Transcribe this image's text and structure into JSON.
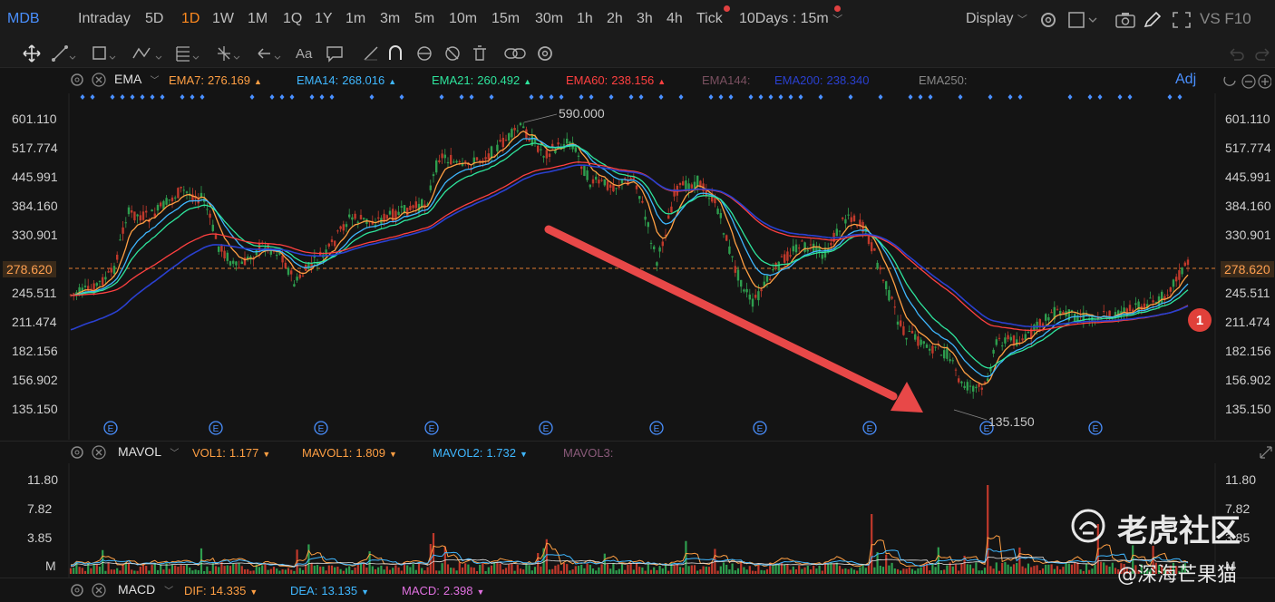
{
  "timeframes": [
    {
      "label": "MDB",
      "kind": "brand"
    },
    {
      "label": "Intraday",
      "kind": "normal"
    },
    {
      "label": "5D",
      "kind": "normal"
    },
    {
      "label": "1D",
      "kind": "active"
    },
    {
      "label": "1W",
      "kind": "normal"
    },
    {
      "label": "1M",
      "kind": "normal"
    },
    {
      "label": "1Q",
      "kind": "normal"
    },
    {
      "label": "1Y",
      "kind": "normal"
    },
    {
      "label": "1m",
      "kind": "normal"
    },
    {
      "label": "3m",
      "kind": "normal"
    },
    {
      "label": "5m",
      "kind": "normal"
    },
    {
      "label": "10m",
      "kind": "normal"
    },
    {
      "label": "15m",
      "kind": "normal"
    },
    {
      "label": "30m",
      "kind": "normal"
    },
    {
      "label": "1h",
      "kind": "normal"
    },
    {
      "label": "2h",
      "kind": "normal"
    },
    {
      "label": "3h",
      "kind": "normal"
    },
    {
      "label": "4h",
      "kind": "normal"
    },
    {
      "label": "Tick",
      "kind": "normal"
    }
  ],
  "multi_period": "10Days : 15m",
  "display_label": "Display",
  "right_text": "VS F10",
  "main_indicator": {
    "name": "EMA",
    "items": [
      {
        "label": "EMA7:",
        "value": "276.169",
        "arrow": "▲",
        "color": "#ff9f43"
      },
      {
        "label": "EMA14:",
        "value": "268.016",
        "arrow": "▲",
        "color": "#3fb7ff"
      },
      {
        "label": "EMA21:",
        "value": "260.492",
        "arrow": "▲",
        "color": "#2ee59d"
      },
      {
        "label": "EMA60:",
        "value": "238.156",
        "arrow": "▲",
        "color": "#ff4040"
      },
      {
        "label": "EMA144:",
        "value": "",
        "arrow": "",
        "color": "#7a5060"
      },
      {
        "label": "EMA200:",
        "value": "238.340",
        "arrow": "",
        "color": "#2a40d0"
      },
      {
        "label": "EMA250:",
        "value": "",
        "arrow": "",
        "color": "#888888"
      }
    ],
    "adj": "Adj"
  },
  "price_axis": [
    "601.110",
    "517.774",
    "445.991",
    "384.160",
    "330.901",
    "278.620",
    "245.511",
    "211.474",
    "182.156",
    "156.902",
    "135.150"
  ],
  "current_price": "278.620",
  "high_label": "590.000",
  "low_label": "135.150",
  "marker_badge": "1",
  "event_marker": "E",
  "volume_indicator": {
    "name": "MAVOL",
    "items": [
      {
        "label": "VOL1:",
        "value": "1.177",
        "arrow": "▼",
        "color": "#ff9f43"
      },
      {
        "label": "MAVOL1:",
        "value": "1.809",
        "arrow": "▼",
        "color": "#ff9f43"
      },
      {
        "label": "MAVOL2:",
        "value": "1.732",
        "arrow": "▼",
        "color": "#3fb7ff"
      },
      {
        "label": "MAVOL3:",
        "value": "",
        "arrow": "",
        "color": "#8a5a7a"
      }
    ]
  },
  "volume_axis": [
    "11.80",
    "7.82",
    "3.85",
    "M"
  ],
  "macd_indicator": {
    "name": "MACD",
    "items": [
      {
        "label": "DIF:",
        "value": "14.335",
        "arrow": "▼",
        "color": "#ff9f43"
      },
      {
        "label": "DEA:",
        "value": "13.135",
        "arrow": "▼",
        "color": "#3fb7ff"
      },
      {
        "label": "MACD:",
        "value": "2.398",
        "arrow": "▼",
        "color": "#e070e0"
      }
    ]
  },
  "watermark": {
    "brand": "老虎社区",
    "author": "@深海芒果猫"
  },
  "colors": {
    "up": "#2e9e4e",
    "down": "#c0392b",
    "ema7": "#ff9f43",
    "ema14": "#3fb7ff",
    "ema21": "#2ee59d",
    "ema60": "#ff4040",
    "ema200": "#2a40d0",
    "arrow": "#e84848"
  }
}
